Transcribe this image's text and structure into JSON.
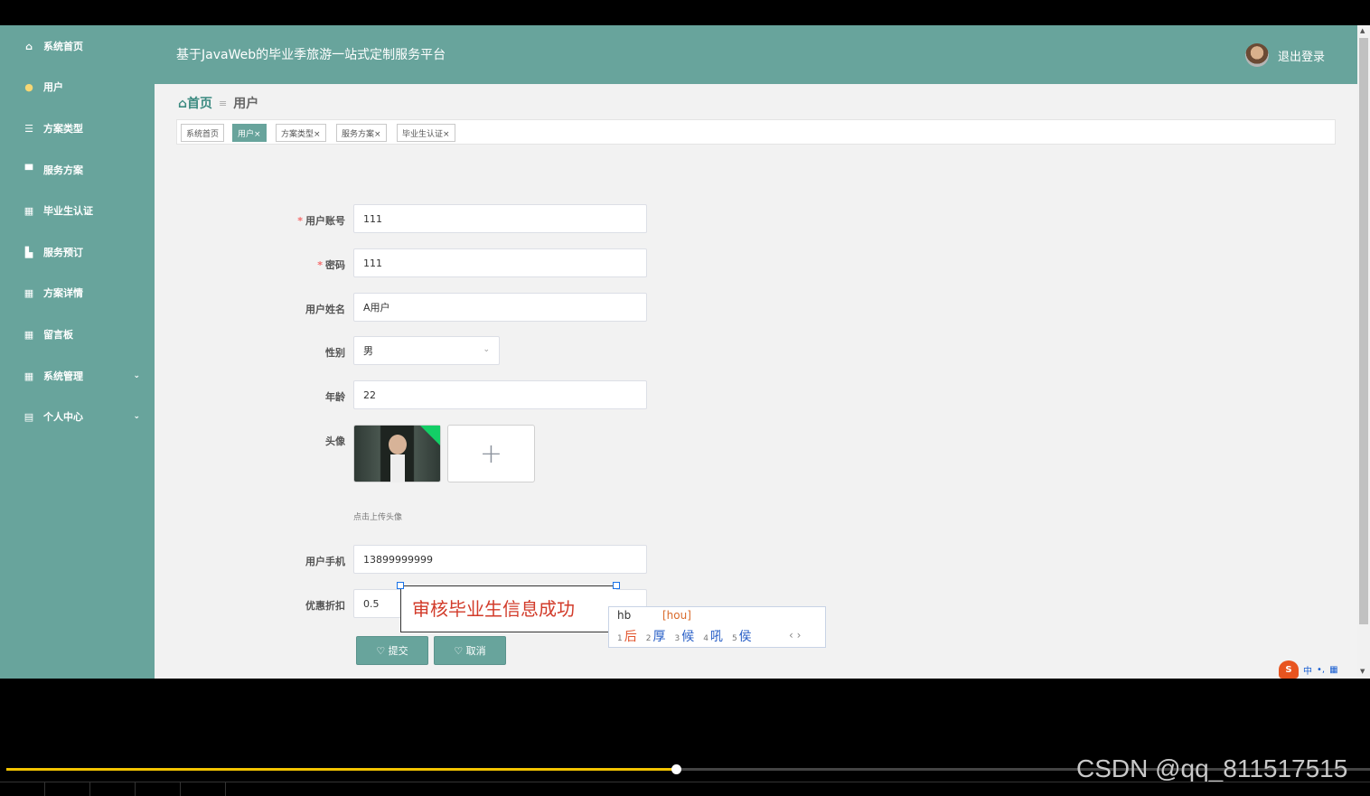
{
  "app": {
    "title": "基于JavaWeb的毕业季旅游一站式定制服务平台",
    "logout": "退出登录"
  },
  "sidebar": {
    "items": [
      {
        "label": "系统首页",
        "icon": "⌂"
      },
      {
        "label": "用户",
        "icon": "●"
      },
      {
        "label": "方案类型",
        "icon": "☰"
      },
      {
        "label": "服务方案",
        "icon": "▀"
      },
      {
        "label": "毕业生认证",
        "icon": "▦"
      },
      {
        "label": "服务预订",
        "icon": "▙"
      },
      {
        "label": "方案详情",
        "icon": "▦"
      },
      {
        "label": "留言板",
        "icon": "▦"
      },
      {
        "label": "系统管理",
        "icon": "▦",
        "chevron": "⌄"
      },
      {
        "label": "个人中心",
        "icon": "▤",
        "chevron": "⌄"
      }
    ]
  },
  "breadcrumb": {
    "home": "⌂首页",
    "sep": "≡",
    "current": "用户"
  },
  "tags": [
    "系统首页",
    "用户×",
    "方案类型×",
    "服务方案×",
    "毕业生认证×"
  ],
  "form": {
    "account": {
      "label": "用户账号",
      "value": "111"
    },
    "password": {
      "label": "密码",
      "value": "111"
    },
    "name": {
      "label": "用户姓名",
      "value": "A用户"
    },
    "gender": {
      "label": "性别",
      "value": "男"
    },
    "age": {
      "label": "年龄",
      "value": "22"
    },
    "avatar": {
      "label": "头像",
      "hint": "点击上传头像"
    },
    "phone": {
      "label": "用户手机",
      "value": "13899999999"
    },
    "discount": {
      "label": "优惠折扣",
      "value": "0.5"
    },
    "required_mark": "*",
    "plus": "+",
    "caret": "⌄"
  },
  "buttons": {
    "submit": "♡ 提交",
    "cancel": "♡ 取消"
  },
  "overlay": {
    "text": "审核毕业生信息成功"
  },
  "ime": {
    "input": "hb",
    "pinyin": "[hou]",
    "candidates": [
      {
        "n": "1",
        "c": "后"
      },
      {
        "n": "2",
        "c": "厚"
      },
      {
        "n": "3",
        "c": "候"
      },
      {
        "n": "4",
        "c": "吼"
      },
      {
        "n": "5",
        "c": "侯"
      }
    ],
    "nav": "‹ ›",
    "tray": [
      "S",
      "中",
      "•,",
      "▦"
    ]
  },
  "watermark": "CSDN @qq_811517515",
  "player": {
    "progress": 0.49
  }
}
